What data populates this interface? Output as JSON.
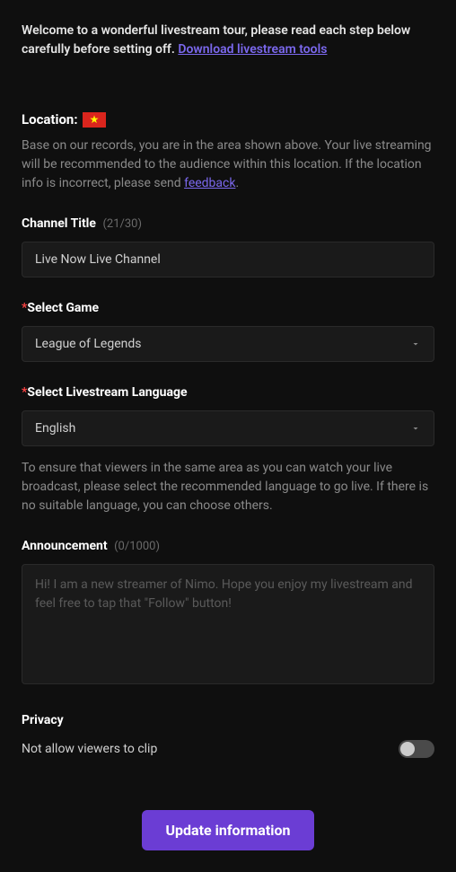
{
  "intro": {
    "text_pre": "Welcome to a wonderful livestream tour, please read each step below carefully before setting off. ",
    "link": "Download livestream tools"
  },
  "location": {
    "label": "Location:",
    "description_pre": "Base on our records, you are in the area shown above. Your live streaming will be recommended to the audience within this location. If the location info is incorrect, please send ",
    "feedback_link": "feedback",
    "description_post": "."
  },
  "channel_title": {
    "label": "Channel Title",
    "counter": "(21/30)",
    "value": "Live Now Live Channel"
  },
  "select_game": {
    "label": "Select Game",
    "value": "League of Legends"
  },
  "select_language": {
    "label": "Select Livestream Language",
    "value": "English",
    "description": "To ensure that viewers in the same area as you can watch your live broadcast, please select the recommended language to go live. If there is no suitable language, you can choose others."
  },
  "announcement": {
    "label": "Announcement",
    "counter": "(0/1000)",
    "placeholder": "Hi! I am a new streamer of Nimo. Hope you enjoy my livestream and feel free to tap that \"Follow\" button!"
  },
  "privacy": {
    "label": "Privacy",
    "toggle_label": "Not allow viewers to clip"
  },
  "submit": {
    "label": "Update information"
  }
}
